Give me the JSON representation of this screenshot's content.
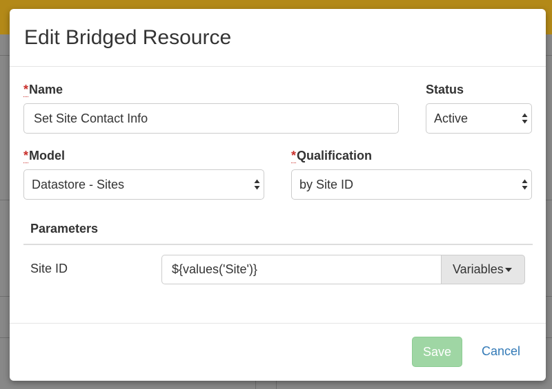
{
  "modal": {
    "title": "Edit Bridged Resource"
  },
  "fields": {
    "name": {
      "required_mark": "*",
      "label": "Name",
      "value": "Set Site Contact Info"
    },
    "status": {
      "label": "Status",
      "value": "Active"
    },
    "model": {
      "required_mark": "*",
      "label": "Model",
      "value": "Datastore - Sites"
    },
    "qualification": {
      "required_mark": "*",
      "label": "Qualification",
      "value": "by Site ID"
    }
  },
  "parameters": {
    "heading": "Parameters",
    "rows": [
      {
        "label": "Site ID",
        "value": "${values('Site')}",
        "button_label": "Variables"
      }
    ]
  },
  "footer": {
    "save_label": "Save",
    "cancel_label": "Cancel"
  },
  "colors": {
    "header_bar": "#b38918",
    "required": "#c9302c",
    "save_disabled": "#9fd6a4",
    "link": "#337ab7"
  }
}
